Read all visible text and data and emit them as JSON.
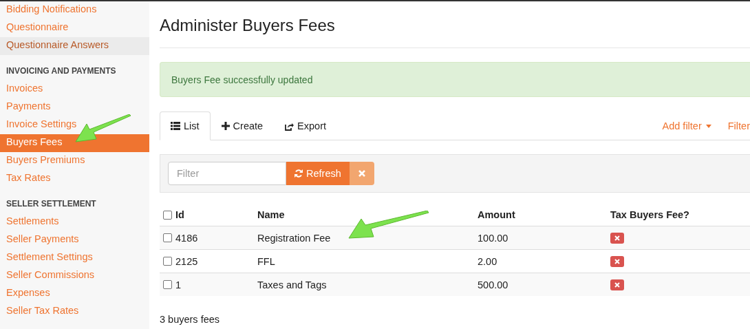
{
  "sidebar": {
    "sections": [
      {
        "items": [
          {
            "label": "Bidding Notifications",
            "selected": false,
            "hovered": false
          },
          {
            "label": "Questionnaire",
            "selected": false,
            "hovered": false
          },
          {
            "label": "Questionnaire Answers",
            "selected": false,
            "hovered": true
          }
        ]
      },
      {
        "heading": "INVOICING AND PAYMENTS",
        "items": [
          {
            "label": "Invoices",
            "selected": false,
            "hovered": false
          },
          {
            "label": "Payments",
            "selected": false,
            "hovered": false
          },
          {
            "label": "Invoice Settings",
            "selected": false,
            "hovered": false
          },
          {
            "label": "Buyers Fees",
            "selected": true,
            "hovered": false
          },
          {
            "label": "Buyers Premiums",
            "selected": false,
            "hovered": false
          },
          {
            "label": "Tax Rates",
            "selected": false,
            "hovered": false
          }
        ]
      },
      {
        "heading": "SELLER SETTLEMENT",
        "items": [
          {
            "label": "Settlements",
            "selected": false,
            "hovered": false
          },
          {
            "label": "Seller Payments",
            "selected": false,
            "hovered": false
          },
          {
            "label": "Settlement Settings",
            "selected": false,
            "hovered": false
          },
          {
            "label": "Seller Commissions",
            "selected": false,
            "hovered": false
          },
          {
            "label": "Expenses",
            "selected": false,
            "hovered": false
          },
          {
            "label": "Seller Tax Rates",
            "selected": false,
            "hovered": false
          }
        ]
      }
    ]
  },
  "page_title": "Administer Buyers Fees",
  "alert": "Buyers Fee successfully updated",
  "tabs": [
    {
      "kind": "list",
      "label": "List",
      "selected": true
    },
    {
      "kind": "create",
      "label": "Create",
      "selected": false
    },
    {
      "kind": "export",
      "label": "Export",
      "selected": false
    }
  ],
  "tab_actions": [
    {
      "label": "Add filter",
      "dropdown": true
    },
    {
      "label": "Filter",
      "dropdown": false
    }
  ],
  "filter": {
    "placeholder": "Filter",
    "refresh_label": "Refresh"
  },
  "table": {
    "select_all_checked": false,
    "columns": [
      "Id",
      "Name",
      "Amount",
      "Tax Buyers Fee?"
    ],
    "rows": [
      {
        "checked": false,
        "id": "4186",
        "name": "Registration Fee",
        "amount": "100.00",
        "tax": false
      },
      {
        "checked": false,
        "id": "2125",
        "name": "FFL",
        "amount": "2.00",
        "tax": false
      },
      {
        "checked": false,
        "id": "1",
        "name": "Taxes and Tags",
        "amount": "500.00",
        "tax": false
      }
    ]
  },
  "footer": "3 buyers fees"
}
